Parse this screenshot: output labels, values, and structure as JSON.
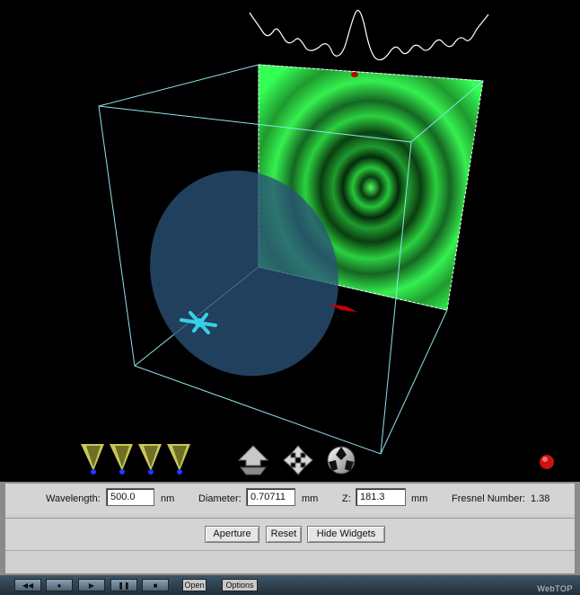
{
  "controls": {
    "wavelength": {
      "label": "Wavelength:",
      "value": "500.0",
      "unit": "nm"
    },
    "diameter": {
      "label": "Diameter:",
      "value": "0.70711",
      "unit": "mm"
    },
    "z": {
      "label": "Z:",
      "value": "181.3",
      "unit": "mm"
    },
    "fresnel": {
      "label": "Fresnel Number:",
      "value": "1.38"
    }
  },
  "buttons": {
    "aperture": "Aperture",
    "reset": "Reset",
    "hide_widgets": "Hide Widgets"
  },
  "player": {
    "buttons": [
      "rewind-icon",
      "record-icon",
      "play-icon",
      "pause-icon",
      "stop-icon"
    ],
    "open_label": "Open",
    "options_label": "Options",
    "brand": "WebTOP"
  },
  "scene": {
    "toolbar_icons": [
      "viewpoint-cone-icon",
      "viewpoint-cone-icon",
      "viewpoint-cone-icon",
      "viewpoint-cone-icon",
      "navigate-arrow-icon",
      "move-cross-icon",
      "examine-ball-icon"
    ],
    "colors": {
      "screen": "#33ff55",
      "aperture": "#1e3a5a",
      "widget": "#35d0e6",
      "box": "#8fe3ea",
      "marker": "#ff0000"
    }
  }
}
